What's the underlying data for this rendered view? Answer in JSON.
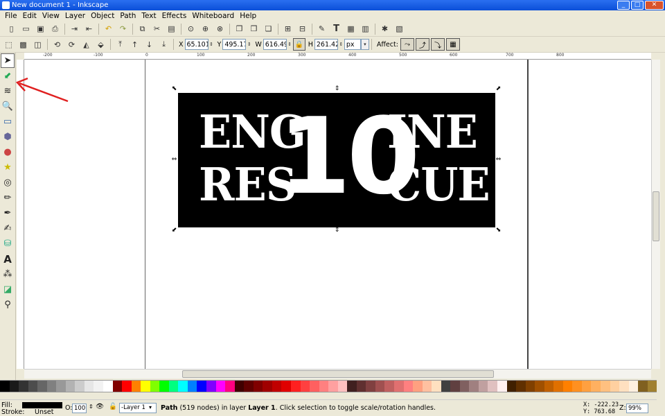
{
  "window": {
    "title": "New document 1 - Inkscape",
    "minimize": "_",
    "maximize": "□",
    "close": "✕"
  },
  "menu": [
    "File",
    "Edit",
    "View",
    "Layer",
    "Object",
    "Path",
    "Text",
    "Effects",
    "Whiteboard",
    "Help"
  ],
  "controls": {
    "x_label": "X",
    "x_value": "65.101",
    "y_label": "Y",
    "y_value": "495.173",
    "w_label": "W",
    "w_value": "616.491",
    "h_label": "H",
    "h_value": "261.429",
    "unit": "px",
    "affect_label": "Affect:"
  },
  "ruler_ticks": [
    "-200",
    "-100",
    "0",
    "100",
    "200",
    "300",
    "400",
    "500",
    "600",
    "700",
    "800"
  ],
  "artwork": {
    "line1_left": "ENG",
    "line1_right": "INE",
    "line2_left": "RES",
    "line2_right": "CUE",
    "center_number": "10"
  },
  "palette_colors": [
    "#000000",
    "#1a1a1a",
    "#333333",
    "#4d4d4d",
    "#666666",
    "#808080",
    "#999999",
    "#b3b3b3",
    "#cccccc",
    "#e6e6e6",
    "#f2f2f2",
    "#ffffff",
    "#800000",
    "#ff0000",
    "#ff8000",
    "#ffff00",
    "#80ff00",
    "#00ff00",
    "#00ff80",
    "#00ffff",
    "#0080ff",
    "#0000ff",
    "#8000ff",
    "#ff00ff",
    "#ff0080",
    "#400000",
    "#600000",
    "#800000",
    "#a00000",
    "#c00000",
    "#e00000",
    "#ff2020",
    "#ff4040",
    "#ff6060",
    "#ff8080",
    "#ffa0a0",
    "#ffc0c0",
    "#402020",
    "#603030",
    "#804040",
    "#a05050",
    "#c06060",
    "#e07070",
    "#ff8080",
    "#ffa080",
    "#ffc0a0",
    "#ffe0c0",
    "#404040",
    "#604040",
    "#806060",
    "#a08080",
    "#c0a0a0",
    "#e0c0c0",
    "#fff0f0",
    "#402000",
    "#603000",
    "#804000",
    "#a05000",
    "#c06000",
    "#e07000",
    "#ff8000",
    "#ff9020",
    "#ffa040",
    "#ffb060",
    "#ffc080",
    "#ffd0a0",
    "#ffe0c0",
    "#fff0e0",
    "#806020",
    "#a08030"
  ],
  "status": {
    "fill_label": "Fill:",
    "stroke_label": "Stroke:",
    "stroke_value": "Unset",
    "opacity_label": "O:",
    "opacity_value": "100",
    "layer_value": "-Layer 1",
    "message_bold_1": "Path",
    "message_1": " (519 nodes) in layer ",
    "message_bold_2": "Layer 1",
    "message_2": ". Click selection to toggle scale/rotation handles.",
    "cursor_x": "X: -222.23",
    "cursor_y": "Y:  763.68",
    "zoom_label": "Z:",
    "zoom_value": "99%"
  },
  "colors": {
    "annotation_arrow": "#e02020",
    "title_blue": "#0b4fd8"
  }
}
